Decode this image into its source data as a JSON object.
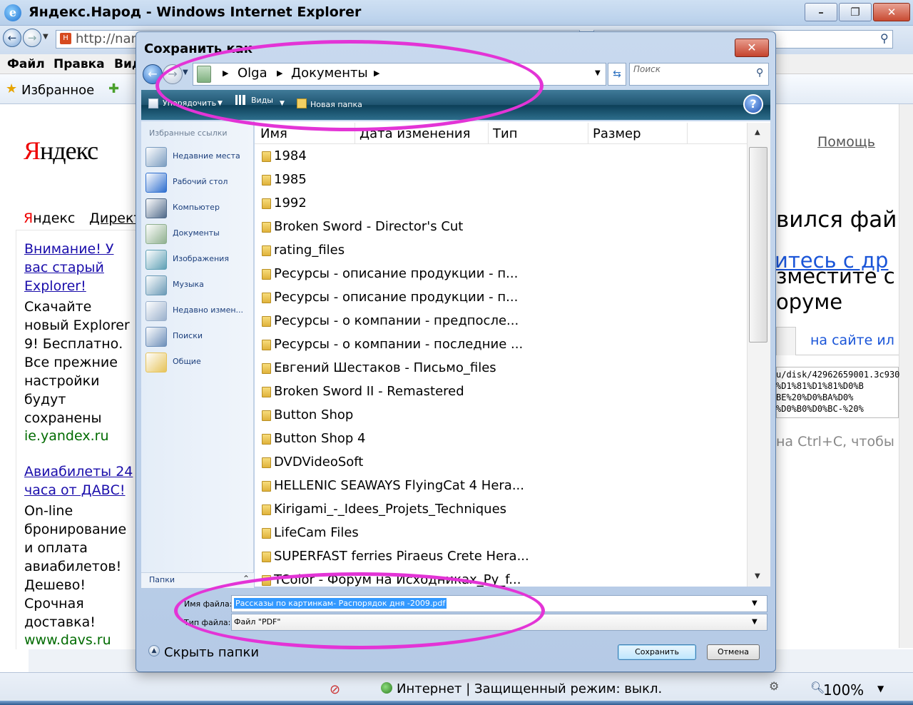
{
  "ie": {
    "title": "Яндекс.Народ - Windows Internet Explorer",
    "address": "http://nar",
    "menu": {
      "file": "Файл",
      "edit": "Правка",
      "view": "Вид"
    },
    "favorites_label": "Избранное",
    "status_text": "Интернет | Защищенный режим: выкл.",
    "zoom": "100%"
  },
  "page": {
    "logo_first": "Я",
    "logo_rest": "ндекс",
    "help": "Помощь",
    "nav_yandex_first": "Я",
    "nav_yandex_rest": "ндекс",
    "nav_direct": "Директ",
    "ads": [
      {
        "title": "Внимание! У вас старый Explorer!",
        "text": "Скачайте новый Explorer 9! Бесплатно. Все прежние настройки будут сохранены",
        "url": "ie.yandex.ru"
      },
      {
        "title": "Авиабилеты 24 часа от ДАВС!",
        "text": "On-line бронирование и оплата авиабилетов! Дешево! Срочная доставка!",
        "url": "www.davs.ru"
      }
    ],
    "right_heading1": "вился фай",
    "right_link": "итесь с др",
    "right_heading2": "зместите с",
    "right_heading3": "оруме",
    "right_tab_other": "на сайте ил",
    "url_lines": [
      "u/disk/42962659001.3c930",
      "%D1%81%D1%81%D0%B",
      "BE%20%D0%BA%D0%",
      "%D0%B0%D0%BC-%20%"
    ],
    "right_hint": "на Ctrl+C, чтобы"
  },
  "dialog": {
    "title": "Сохранить как",
    "breadcrumb": [
      "Olga",
      "Документы"
    ],
    "search_placeholder": "Поиск",
    "toolbar": {
      "organize": "Упорядочить",
      "views": "Виды",
      "new_folder": "Новая папка",
      "help": "?"
    },
    "sidebar": {
      "header": "Избранные ссылки",
      "items": [
        {
          "label": "Недавние места",
          "icon": "recent-places-icon",
          "color": "#7a9cc0"
        },
        {
          "label": "Рабочий стол",
          "icon": "desktop-icon",
          "color": "#2f6fcf"
        },
        {
          "label": "Компьютер",
          "icon": "computer-icon",
          "color": "#506a8a"
        },
        {
          "label": "Документы",
          "icon": "documents-icon",
          "color": "#8fb08f"
        },
        {
          "label": "Изображения",
          "icon": "pictures-icon",
          "color": "#5fa0b5"
        },
        {
          "label": "Музыка",
          "icon": "music-icon",
          "color": "#6a9ab6"
        },
        {
          "label": "Недавно измен...",
          "icon": "recently-changed-icon",
          "color": "#9ab0cc"
        },
        {
          "label": "Поиски",
          "icon": "searches-icon",
          "color": "#6d8fb9"
        },
        {
          "label": "Общие",
          "icon": "public-folder-icon",
          "color": "#e6c35a"
        }
      ],
      "folders_label": "Папки"
    },
    "columns": [
      "Имя",
      "Дата изменения",
      "Тип",
      "Размер"
    ],
    "files": [
      "1984",
      "1985",
      "1992",
      "Broken Sword - Director's Cut",
      "rating_files",
      "Ресурсы - описание продукции - п...",
      "Ресурсы - описание продукции - п...",
      "Ресурсы - о компании - предпосле...",
      "Ресурсы - о компании - последние ...",
      "Евгений Шестаков - Письмо_files",
      "Broken Sword II - Remastered",
      "Button Shop",
      "Button Shop 4",
      "DVDVideoSoft",
      "HELLENIC SEAWAYS FlyingCat 4 Hera...",
      "Kirigami_-_Idees_Projets_Techniques",
      "LifeCam Files",
      "SUPERFAST ferries Piraeus Crete Hera...",
      "TColor - Форум на Исходниках_Ру_f..."
    ],
    "filename_label": "Имя файла:",
    "filename_value": "Рассказы по картинкам- Распорядок дня -2009.pdf",
    "filetype_label": "Тип файла:",
    "filetype_value": "Файл \"PDF\"",
    "hide_folders": "Скрыть папки",
    "save": "Сохранить",
    "cancel": "Отмена"
  },
  "annotation_color": "#e334d6"
}
